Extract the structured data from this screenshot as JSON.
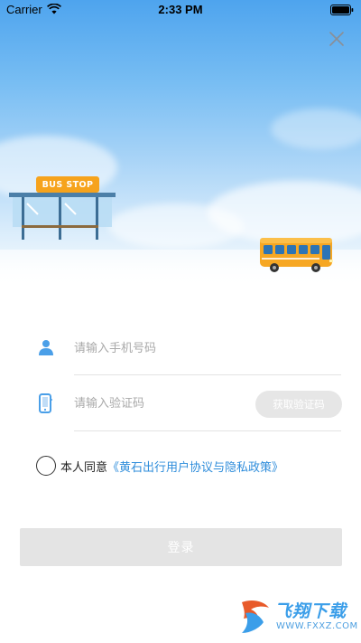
{
  "status_bar": {
    "carrier": "Carrier",
    "time": "2:33 PM"
  },
  "hero": {
    "bus_stop_sign": "BUS  STOP"
  },
  "form": {
    "phone_placeholder": "请输入手机号码",
    "phone_value": "",
    "code_placeholder": "请输入验证码",
    "code_value": "",
    "get_code_label": "获取验证码"
  },
  "agreement": {
    "checked": false,
    "prefix": "本人同意",
    "link": "《黄石出行用户协议与隐私政策》"
  },
  "login_label": "登录",
  "watermark": {
    "title": "飞翔下载",
    "url": "WWW.FXXZ.COM"
  },
  "colors": {
    "accent": "#2f8ddb",
    "icon_blue": "#4a9fe8",
    "disabled_button": "#e4e4e4",
    "bus_stop_orange": "#f6a31c",
    "bus_body": "#f6a723"
  },
  "icons": {
    "close": "close-icon",
    "user": "user-icon",
    "mobile": "mobile-phone-icon",
    "wifi": "wifi-icon",
    "battery": "battery-icon"
  }
}
